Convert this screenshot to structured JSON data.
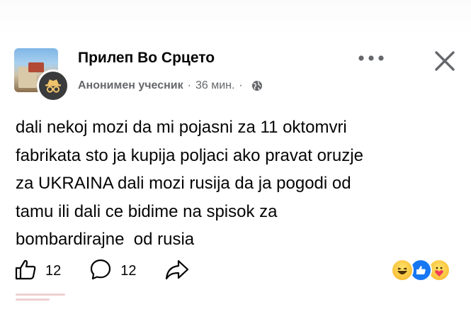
{
  "post": {
    "group_name": "Прилеп Во Срцето",
    "author": "Анонимен учесник",
    "separator": "·",
    "time_ago": "36 мин.",
    "privacy_icon": "globe-icon",
    "text": "dali nekoj mozi da mi pojasni za 11 oktomvri\nfabrikata sto ja kupija poljaci ako pravat oruzje\nza UKRAINA dali mozi rusija da ja pogodi od\ntamu ili dali ce bidime na spisok za\nbombardirajne  od rusia"
  },
  "actions": {
    "like_count": "12",
    "comment_count": "12",
    "like_icon": "thumbs-up-icon",
    "comment_icon": "comment-icon",
    "share_icon": "share-icon"
  },
  "reactions": [
    "haha-icon",
    "like-reaction-icon",
    "care-icon"
  ],
  "colors": {
    "text": "#050505",
    "meta": "#65676b",
    "like_blue": "#1877f2",
    "emoji_yellow": "#f7b125"
  }
}
